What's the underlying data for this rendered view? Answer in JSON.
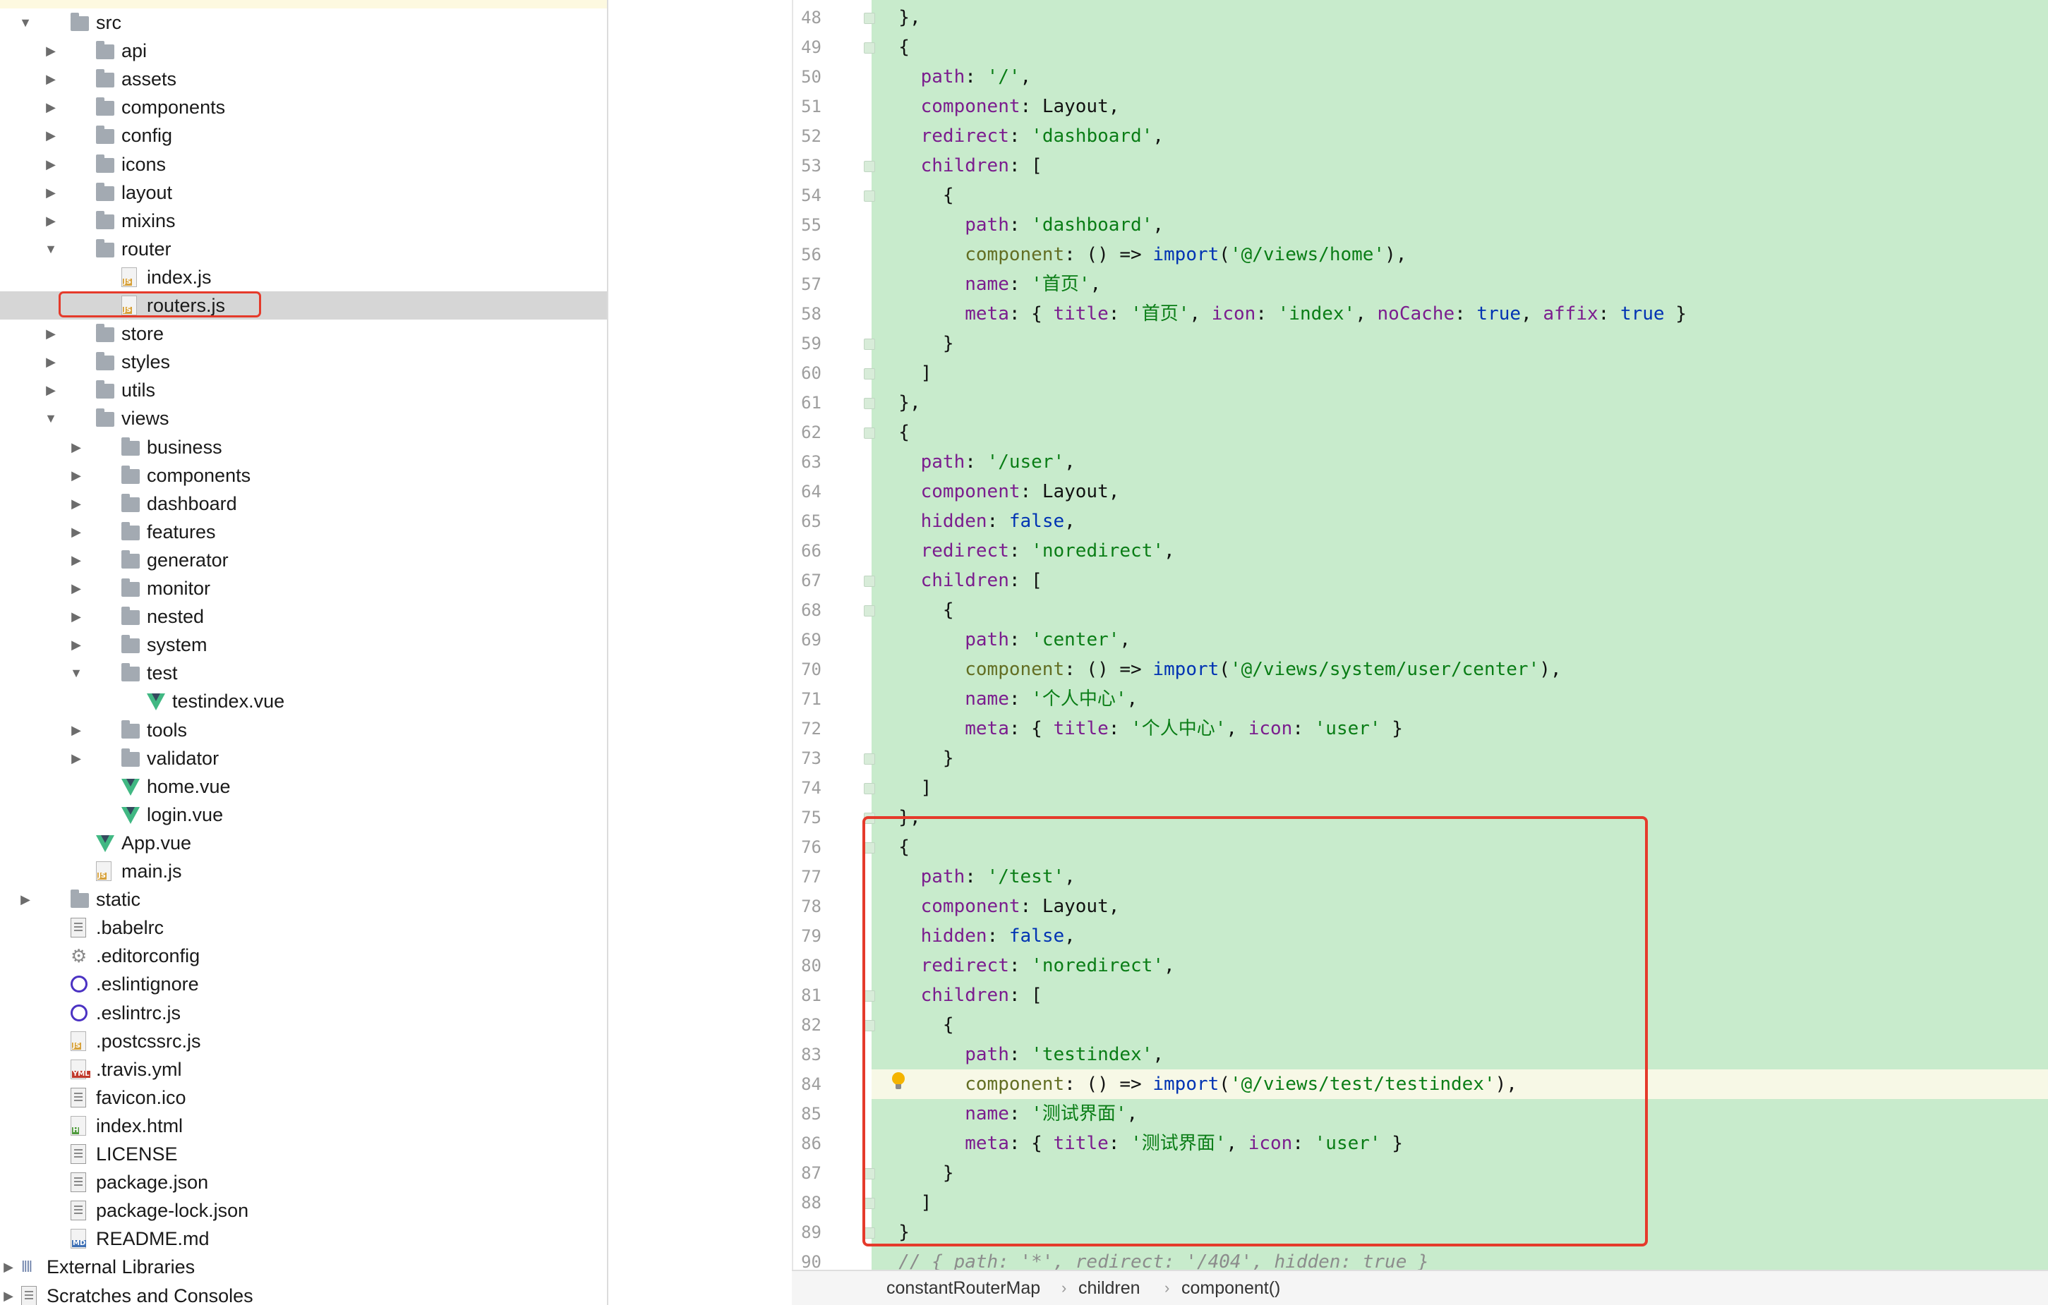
{
  "tree": {
    "selected_file": "routers.js",
    "items": [
      {
        "label": "src",
        "type": "folder",
        "depth": 1,
        "expanded": true
      },
      {
        "label": "api",
        "type": "folder",
        "depth": 2,
        "expanded": false
      },
      {
        "label": "assets",
        "type": "folder",
        "depth": 2,
        "expanded": false
      },
      {
        "label": "components",
        "type": "folder",
        "depth": 2,
        "expanded": false
      },
      {
        "label": "config",
        "type": "folder",
        "depth": 2,
        "expanded": false
      },
      {
        "label": "icons",
        "type": "folder",
        "depth": 2,
        "expanded": false
      },
      {
        "label": "layout",
        "type": "folder",
        "depth": 2,
        "expanded": false
      },
      {
        "label": "mixins",
        "type": "folder",
        "depth": 2,
        "expanded": false
      },
      {
        "label": "router",
        "type": "folder",
        "depth": 2,
        "expanded": true
      },
      {
        "label": "index.js",
        "type": "js",
        "depth": 3
      },
      {
        "label": "routers.js",
        "type": "js",
        "depth": 3,
        "selected": true
      },
      {
        "label": "store",
        "type": "folder",
        "depth": 2,
        "expanded": false
      },
      {
        "label": "styles",
        "type": "folder",
        "depth": 2,
        "expanded": false
      },
      {
        "label": "utils",
        "type": "folder",
        "depth": 2,
        "expanded": false
      },
      {
        "label": "views",
        "type": "folder",
        "depth": 2,
        "expanded": true
      },
      {
        "label": "business",
        "type": "folder",
        "depth": 3,
        "expanded": false
      },
      {
        "label": "components",
        "type": "folder",
        "depth": 3,
        "expanded": false
      },
      {
        "label": "dashboard",
        "type": "folder",
        "depth": 3,
        "expanded": false
      },
      {
        "label": "features",
        "type": "folder",
        "depth": 3,
        "expanded": false
      },
      {
        "label": "generator",
        "type": "folder",
        "depth": 3,
        "expanded": false
      },
      {
        "label": "monitor",
        "type": "folder",
        "depth": 3,
        "expanded": false
      },
      {
        "label": "nested",
        "type": "folder",
        "depth": 3,
        "expanded": false
      },
      {
        "label": "system",
        "type": "folder",
        "depth": 3,
        "expanded": false
      },
      {
        "label": "test",
        "type": "folder",
        "depth": 3,
        "expanded": true
      },
      {
        "label": "testindex.vue",
        "type": "vue",
        "depth": 4
      },
      {
        "label": "tools",
        "type": "folder",
        "depth": 3,
        "expanded": false
      },
      {
        "label": "validator",
        "type": "folder",
        "depth": 3,
        "expanded": false
      },
      {
        "label": "home.vue",
        "type": "vue",
        "depth": 3
      },
      {
        "label": "login.vue",
        "type": "vue",
        "depth": 3
      },
      {
        "label": "App.vue",
        "type": "vue",
        "depth": 2
      },
      {
        "label": "main.js",
        "type": "js",
        "depth": 2
      },
      {
        "label": "static",
        "type": "folder",
        "depth": 1,
        "expanded": false
      },
      {
        "label": ".babelrc",
        "type": "config",
        "depth": 1
      },
      {
        "label": ".editorconfig",
        "type": "gear",
        "depth": 1
      },
      {
        "label": ".eslintignore",
        "type": "eslint",
        "depth": 1
      },
      {
        "label": ".eslintrc.js",
        "type": "eslint",
        "depth": 1
      },
      {
        "label": ".postcssrc.js",
        "type": "js",
        "depth": 1
      },
      {
        "label": ".travis.yml",
        "type": "yml",
        "depth": 1
      },
      {
        "label": "favicon.ico",
        "type": "file",
        "depth": 1
      },
      {
        "label": "index.html",
        "type": "html",
        "depth": 1
      },
      {
        "label": "LICENSE",
        "type": "file",
        "depth": 1
      },
      {
        "label": "package.json",
        "type": "config",
        "depth": 1
      },
      {
        "label": "package-lock.json",
        "type": "config",
        "depth": 1
      },
      {
        "label": "README.md",
        "type": "md",
        "depth": 1
      },
      {
        "label": "External Libraries",
        "type": "libs",
        "depth": 0,
        "expanded": false
      },
      {
        "label": "Scratches and Consoles",
        "type": "scratch",
        "depth": 0,
        "expanded": false
      }
    ]
  },
  "editor": {
    "first_line": 48,
    "last_line": 90,
    "current_line": 84,
    "lines": [
      "  },",
      "  {",
      "    path: '/',",
      "    component: Layout,",
      "    redirect: 'dashboard',",
      "    children: [",
      "      {",
      "        path: 'dashboard',",
      "        component: () => import('@/views/home'),",
      "        name: '首页',",
      "        meta: { title: '首页', icon: 'index', noCache: true, affix: true }",
      "      }",
      "    ]",
      "  },",
      "  {",
      "    path: '/user',",
      "    component: Layout,",
      "    hidden: false,",
      "    redirect: 'noredirect',",
      "    children: [",
      "      {",
      "        path: 'center',",
      "        component: () => import('@/views/system/user/center'),",
      "        name: '个人中心',",
      "        meta: { title: '个人中心', icon: 'user' }",
      "      }",
      "    ]",
      "  },",
      "  {",
      "    path: '/test',",
      "    component: Layout,",
      "    hidden: false,",
      "    redirect: 'noredirect',",
      "    children: [",
      "      {",
      "        path: 'testindex',",
      "        component: () => import('@/views/test/testindex'),",
      "        name: '测试界面',",
      "        meta: { title: '测试界面', icon: 'user' }",
      "      }",
      "    ]",
      "  }",
      "  // { path: '*', redirect: '/404', hidden: true }"
    ]
  },
  "breadcrumb": [
    "constantRouterMap",
    "children",
    "component()"
  ],
  "colors": {
    "code_background": "#c8ebcc",
    "annotation_red": "#e53a2b",
    "selection_gray": "#d6d6d6"
  }
}
